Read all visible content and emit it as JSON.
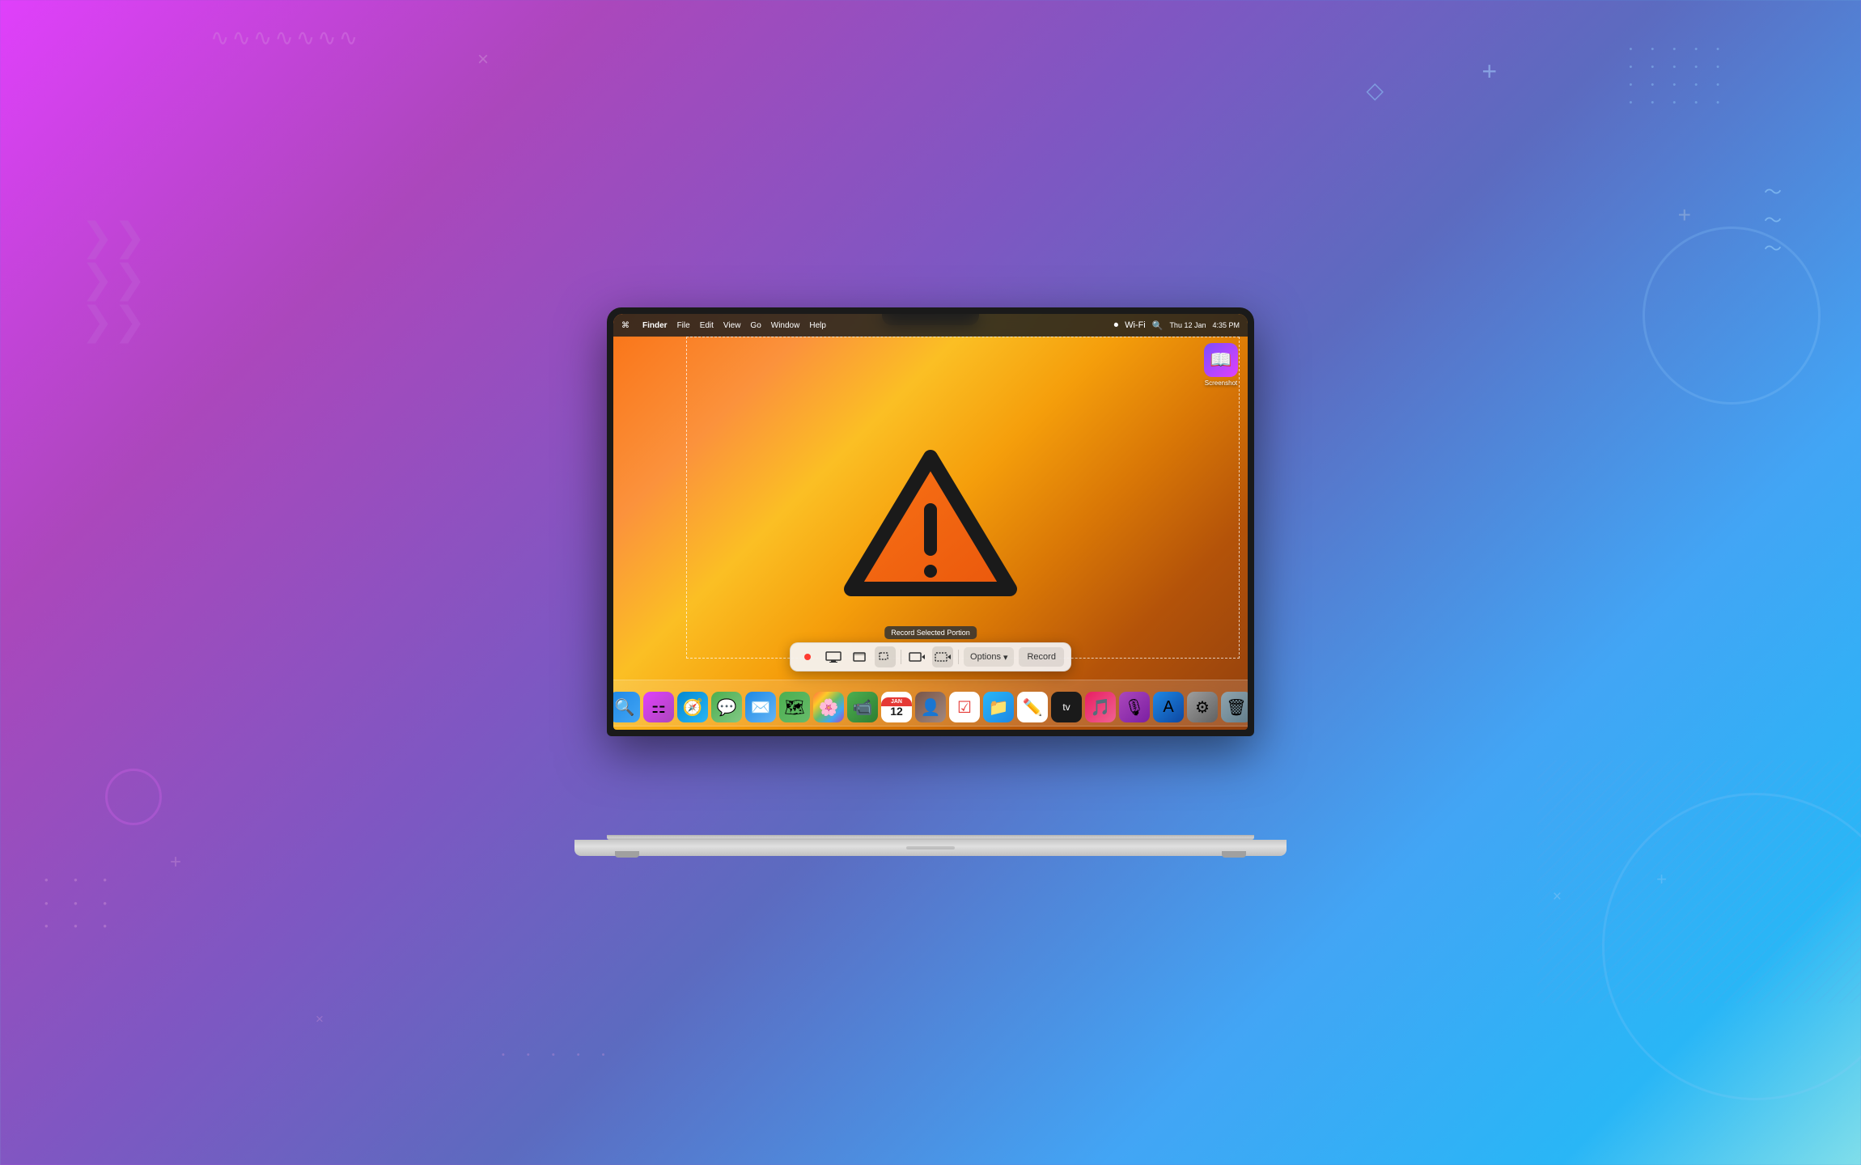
{
  "background": {
    "gradient_desc": "purple to blue gradient background"
  },
  "macbook": {
    "screen": {
      "menubar": {
        "apple": "⌘",
        "items": [
          "Finder",
          "File",
          "Edit",
          "View",
          "Go",
          "Window",
          "Help"
        ],
        "right_items": [
          "Thu 12 Jan",
          "4:35 PM"
        ]
      },
      "desktop": {
        "wallpaper_desc": "macOS Ventura orange gradient wallpaper with warning triangle icon"
      },
      "tooltip": {
        "text": "Record Selected Portion"
      },
      "toolbar": {
        "options_label": "Options",
        "record_label": "Record",
        "options_arrow": "▾"
      },
      "desktop_icon": {
        "label": "Screenshot"
      }
    }
  },
  "decorations": {
    "chevrons": "»»",
    "waves": "~~~~",
    "dots": "• • • •",
    "plus": "+",
    "x_mark": "×",
    "diamond": "◇",
    "wavy_lines": "≈≈≈≈"
  }
}
